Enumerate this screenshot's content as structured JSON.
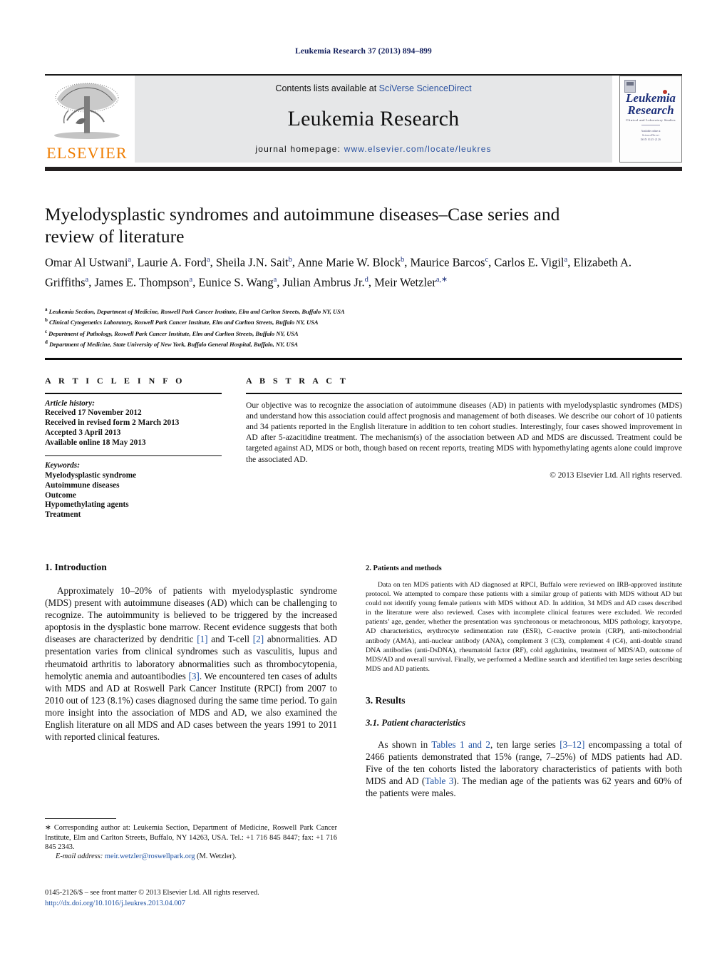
{
  "running_head": "Leukemia Research 37 (2013) 894–899",
  "masthead": {
    "elsevier_wordmark": "ELSEVIER",
    "contents_prefix": "Contents lists available at ",
    "contents_link": "SciVerse ScienceDirect",
    "journal_name": "Leukemia Research",
    "homepage_prefix": "journal homepage: ",
    "homepage_url": "www.elsevier.com/locate/leukres",
    "cover": {
      "title_line1": "Leukemia",
      "title_line2": "Research",
      "subtitle": "Clinical and Laboratory Studies",
      "meta_line1": "Available online at",
      "meta_line2": "ScienceDirect",
      "meta_line3": "ISSN 0145-2126"
    }
  },
  "article": {
    "title": "Myelodysplastic syndromes and autoimmune diseases–Case series and review of literature",
    "authors_html": "Omar Al Ustwani<sup>a</sup>, Laurie A. Ford<sup>a</sup>, Sheila J.N. Sait<sup>b</sup>, Anne Marie W. Block<sup>b</sup>, Maurice Barcos<sup>c</sup>, Carlos E. Vigil<sup>a</sup>, Elizabeth A. Griffiths<sup>a</sup>, James E. Thompson<sup>a</sup>, Eunice S. Wang<sup>a</sup>, Julian Ambrus Jr.<sup>d</sup>, Meir Wetzler<sup>a,<span class=\"star\">∗</span></sup>",
    "affiliations": [
      {
        "marker": "a",
        "text": "Leukemia Section, Department of Medicine, Roswell Park Cancer Institute, Elm and Carlton Streets, Buffalo NY, USA"
      },
      {
        "marker": "b",
        "text": "Clinical Cytogenetics Laboratory, Roswell Park Cancer Institute, Elm and Carlton Streets, Buffalo NY, USA"
      },
      {
        "marker": "c",
        "text": "Department of Pathology, Roswell Park Cancer Institute, Elm and Carlton Streets, Buffalo NY, USA"
      },
      {
        "marker": "d",
        "text": "Department of Medicine, State University of New York, Buffalo General Hospital, Buffalo, NY, USA"
      }
    ]
  },
  "article_info": {
    "heading": "A R T I C L E   I N F O",
    "history_label": "Article history:",
    "history": [
      "Received 17 November 2012",
      "Received in revised form 2 March 2013",
      "Accepted 3 April 2013",
      "Available online 18 May 2013"
    ],
    "keywords_label": "Keywords:",
    "keywords": [
      "Myelodysplastic syndrome",
      "Autoimmune diseases",
      "Outcome",
      "Hypomethylating agents",
      "Treatment"
    ]
  },
  "abstract": {
    "heading": "A B S T R A C T",
    "text": "Our objective was to recognize the association of autoimmune diseases (AD) in patients with myelodysplastic syndromes (MDS) and understand how this association could affect prognosis and management of both diseases. We describe our cohort of 10 patients and 34 patients reported in the English literature in addition to ten cohort studies. Interestingly, four cases showed improvement in AD after 5-azacitidine treatment. The mechanism(s) of the association between AD and MDS are discussed. Treatment could be targeted against AD, MDS or both, though based on recent reports, treating MDS with hypomethylating agents alone could improve the associated AD.",
    "copyright": "© 2013 Elsevier Ltd. All rights reserved."
  },
  "sections": {
    "introduction": {
      "heading": "1.  Introduction",
      "paragraph_html": "Approximately 10–20% of patients with myelodysplastic syndrome (MDS) present with autoimmune diseases (AD) which can be challenging to recognize. The autoimmunity is believed to be triggered by the increased apoptosis in the dysplastic bone marrow. Recent evidence suggests that both diseases are characterized by dendritic <span class=\"ref\">[1]</span> and T-cell <span class=\"ref\">[2]</span> abnormalities. AD presentation varies from clinical syndromes such as vasculitis, lupus and rheumatoid arthritis to laboratory abnormalities such as thrombocytopenia, hemolytic anemia and autoantibodies <span class=\"ref\">[3]</span>. We encountered ten cases of adults with MDS and AD at Roswell Park Cancer Institute (RPCI) from 2007 to 2010 out of 123 (8.1%) cases diagnosed during the same time period. To gain more insight into the association of MDS and AD, we also examined the English literature on all MDS and AD cases between the years 1991 to 2011 with reported clinical features."
    },
    "patients_methods": {
      "heading": "2.  Patients and methods",
      "paragraph": "Data on ten MDS patients with AD diagnosed at RPCI, Buffalo were reviewed on IRB-approved institute protocol. We attempted to compare these patients with a similar group of patients with MDS without AD but could not identify young female patients with MDS without AD. In addition, 34 MDS and AD cases described in the literature were also reviewed. Cases with incomplete clinical features were excluded. We recorded patients’ age, gender, whether the presentation was synchronous or metachronous, MDS pathology, karyotype, AD characteristics, erythrocyte sedimentation rate (ESR), C-reactive protein (CRP), anti-mitochondrial antibody (AMA), anti-nuclear antibody (ANA), complement 3 (C3), complement 4 (C4), anti-double strand DNA antibodies (anti-DsDNA), rheumatoid factor (RF), cold agglutinins, treatment of MDS/AD, outcome of MDS/AD and overall survival. Finally, we performed a Medline search and identified ten large series describing MDS and AD patients."
    },
    "results": {
      "heading": "3.  Results",
      "subheading": "3.1.  Patient characteristics",
      "paragraph_html": "As shown in <span class=\"ref\">Tables 1 and 2</span>, ten large series <span class=\"ref\">[3–12]</span> encompassing a total of 2466 patients demonstrated that 15% (range, 7–25%) of MDS patients had AD. Five of the ten cohorts listed the laboratory characteristics of patients with both MDS and AD (<span class=\"ref\">Table 3</span>). The median age of the patients was 62 years and 60% of the patients were males."
    }
  },
  "footnotes": {
    "corresponding_html": "<span class=\"star\">∗</span> Corresponding author at: Leukemia Section, Department of Medicine, Roswell Park Cancer Institute, Elm and Carlton Streets, Buffalo, NY 14263, USA. Tel.: +1 716 845 8447; fax: +1 716 845 2343.",
    "email_label": "E-mail address:",
    "email": "meir.wetzler@roswellpark.org",
    "email_suffix": "(M. Wetzler).",
    "front_matter": "0145-2126/$ – see front matter © 2013 Elsevier Ltd. All rights reserved.",
    "doi": "http://dx.doi.org/10.1016/j.leukres.2013.04.007"
  }
}
